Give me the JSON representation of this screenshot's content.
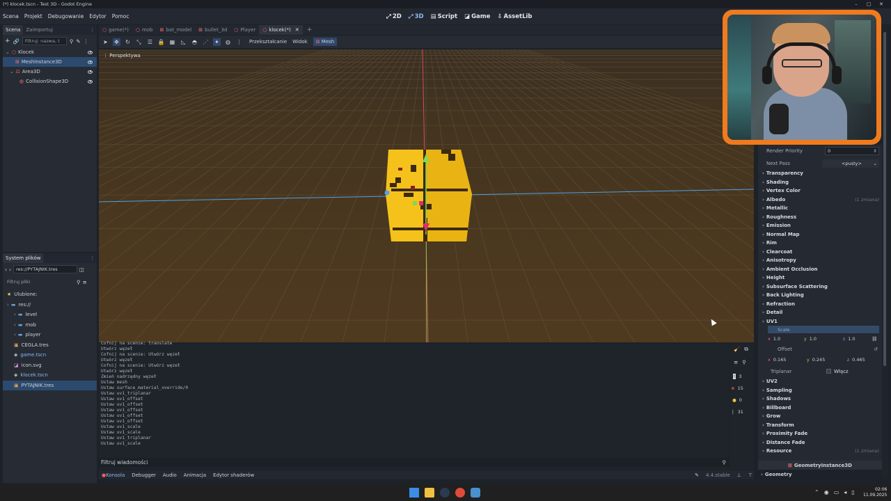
{
  "window": {
    "title": "(*) klocek.tscn - Test 3D - Godot Engine"
  },
  "menu": [
    "Scena",
    "Projekt",
    "Debugowanie",
    "Edytor",
    "Pomoc"
  ],
  "workspaces": [
    {
      "label": "2D",
      "active": false
    },
    {
      "label": "3D",
      "active": true
    },
    {
      "label": "Script",
      "active": false
    },
    {
      "label": "Game",
      "active": false
    },
    {
      "label": "AssetLib",
      "active": false
    }
  ],
  "scene_dock": {
    "tabs": [
      "Scena",
      "Zaimportuj"
    ],
    "filter_placeholder": "Filtruj: nazwa, t",
    "nodes": [
      {
        "name": "Klocek",
        "indent": 0,
        "selected": false
      },
      {
        "name": "MeshInstance3D",
        "indent": 1,
        "selected": true
      },
      {
        "name": "Area3D",
        "indent": 1,
        "selected": false
      },
      {
        "name": "CollisionShape3D",
        "indent": 2,
        "selected": false
      }
    ]
  },
  "filesystem": {
    "title": "System plików",
    "path": "res://PYTAJNIK.tres",
    "filter_placeholder": "Filtruj pliki",
    "items": [
      {
        "name": "Ulubione:",
        "type": "star",
        "indent": 0,
        "selected": false
      },
      {
        "name": "res://",
        "type": "folder",
        "indent": 0,
        "selected": false
      },
      {
        "name": "level",
        "type": "folder",
        "indent": 1,
        "selected": false
      },
      {
        "name": "mob",
        "type": "folder",
        "indent": 1,
        "selected": false
      },
      {
        "name": "player",
        "type": "folder",
        "indent": 1,
        "selected": false
      },
      {
        "name": "CEGLA.tres",
        "type": "res",
        "indent": 1,
        "selected": false
      },
      {
        "name": "game.tscn",
        "type": "scene",
        "indent": 1,
        "selected": false
      },
      {
        "name": "icon.svg",
        "type": "image",
        "indent": 1,
        "selected": false
      },
      {
        "name": "klocek.tscn",
        "type": "scene",
        "indent": 1,
        "selected": false
      },
      {
        "name": "PYTAJNIK.tres",
        "type": "res",
        "indent": 1,
        "selected": true
      }
    ]
  },
  "scene_tabs": [
    "game(*)",
    "mob",
    "bat_model",
    "bullet_3d",
    "Player",
    "klocek(*)"
  ],
  "viewport": {
    "toolbar_menus": [
      "Przekształcanie",
      "Widok",
      "Mesh"
    ],
    "view_label": "Perspektywa"
  },
  "output": {
    "lines": [
      "Cofnij na scenie: translate",
      "Utwórz węzeł",
      "Cofnij na scenie: Utwórz węzeł",
      "Utwórz węzeł",
      "Cofnij na scenie: Utwórz węzeł",
      "Utwórz węzeł",
      "Zmień nadrzędny węzeł",
      "Ustaw mesh",
      "Ustaw surface_material_override/0",
      "Ustaw uv1_triplanar",
      "Ustaw uv1_offset",
      "Ustaw uv1_offset",
      "Ustaw uv1_offset",
      "Ustaw uv1_offset",
      "Ustaw uv1_offset",
      "Ustaw uv1_scale",
      "Ustaw uv1_scale",
      "Ustaw uv1_triplanar",
      "Ustaw uv1_scale"
    ],
    "filter_placeholder": "Filtruj wiadomości",
    "counts": [
      "3",
      "15",
      "0",
      "31"
    ]
  },
  "bottom_tabs": [
    "Konsola",
    "Debugger",
    "Audio",
    "Animacja",
    "Edytor shaderów"
  ],
  "version": "4.4.stable",
  "inspector": {
    "render_priority": {
      "label": "Render Priority",
      "value": "0"
    },
    "next_pass": {
      "label": "Next Pass",
      "value": "<pusty>"
    },
    "sections_a": [
      "Transparency",
      "Shading",
      "Vertex Color",
      "Albedo",
      "Metallic",
      "Roughness",
      "Emission",
      "Normal Map",
      "Rim",
      "Clearcoat",
      "Anisotropy",
      "Ambient Occlusion",
      "Height",
      "Subsurface Scattering",
      "Back Lighting",
      "Refraction",
      "Detail",
      "UV1"
    ],
    "albedo_note": "(1 zmiana)",
    "uv1": {
      "scale_label": "Scale",
      "scale": [
        "1.0",
        "1.0",
        "1.0"
      ],
      "offset_label": "Offset",
      "offset": [
        "0.165",
        "0.245",
        "0.465"
      ],
      "triplanar_label": "Triplanar",
      "triplanar_value": "Włącz"
    },
    "sections_b": [
      "UV2",
      "Sampling",
      "Shadows",
      "Billboard",
      "Grow",
      "Transform",
      "Proximity Fade",
      "Distance Fade",
      "Resource"
    ],
    "resource_note": "(1 zmiana)",
    "footer_class": "GeometryInstance3D",
    "footer_section": "Geometry"
  },
  "clock": {
    "time": "02:06",
    "date": "11.09.2025"
  },
  "colors": {
    "accent": "#3d6fb0",
    "cube": "#f5c21b",
    "cam_border": "#f07a1e"
  }
}
